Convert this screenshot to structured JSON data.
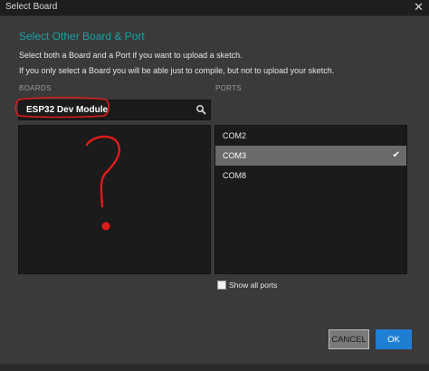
{
  "window": {
    "title": "Select Board",
    "close_glyph": "✕"
  },
  "dialog": {
    "heading": "Select Other Board & Port",
    "description_1": "Select both a Board and a Port if you want to upload a sketch.",
    "description_2": "If you only select a Board you will be able just to compile, but not to upload your sketch."
  },
  "boards": {
    "label": "BOARDS",
    "search_value": "ESP32 Dev Module",
    "search_icon": "search-icon"
  },
  "ports": {
    "label": "PORTS",
    "items": [
      {
        "label": "COM2",
        "selected": false
      },
      {
        "label": "COM3",
        "selected": true
      },
      {
        "label": "COM8",
        "selected": false
      }
    ],
    "check_glyph": "✔"
  },
  "options": {
    "show_all_ports_label": "Show all ports",
    "show_all_ports_checked": false
  },
  "buttons": {
    "cancel_label": "CANCEL",
    "ok_label": "OK"
  },
  "colors": {
    "accent": "#17a1a5",
    "primary_button": "#1e7fd2",
    "annotation": "#e01b1b"
  }
}
